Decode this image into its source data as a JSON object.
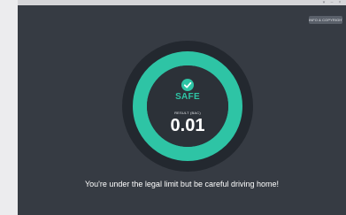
{
  "topbar": {
    "controls": [
      "▾",
      "–",
      "×"
    ]
  },
  "header": {
    "info_button_label": "INFO & COPYRIGHT"
  },
  "gauge": {
    "status": "SAFE",
    "result_label": "RESULT (BAC)",
    "result_value": "0.01",
    "status_icon": "check-icon",
    "colors": {
      "accent": "#2ec4a5",
      "outer_ring": "#23282f",
      "inner_fill": "#2c3138",
      "background": "#363b43"
    }
  },
  "message": "You're under the legal limit but be careful driving home!"
}
